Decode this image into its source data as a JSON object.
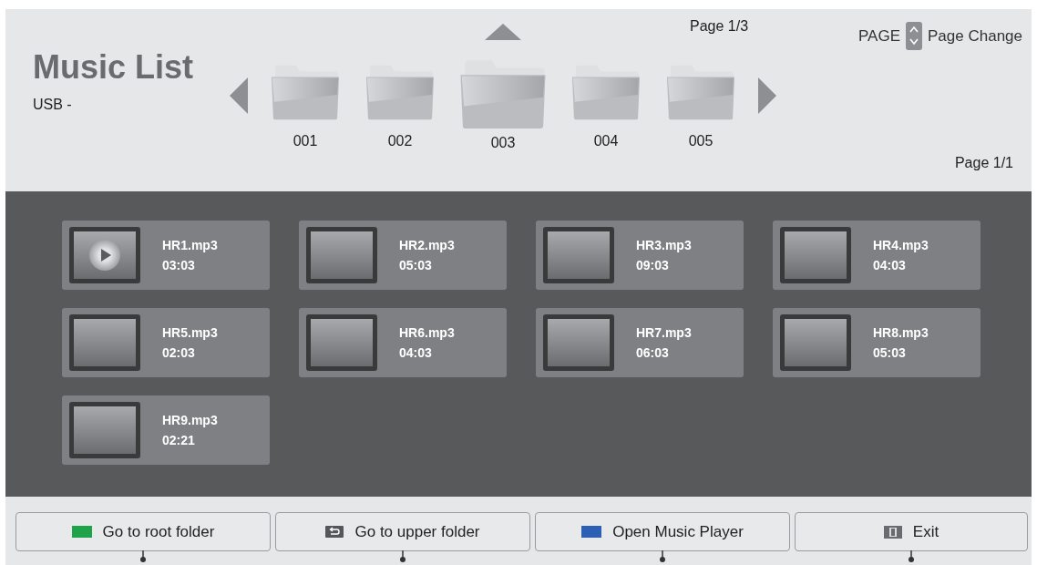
{
  "header": {
    "title": "Music List",
    "source": "USB -",
    "folder_page": "Page 1/3",
    "page_key": "PAGE",
    "page_hint": "Page Change",
    "file_page": "Page 1/1"
  },
  "folders": [
    {
      "label": "001",
      "selected": false
    },
    {
      "label": "002",
      "selected": false
    },
    {
      "label": "003",
      "selected": true
    },
    {
      "label": "004",
      "selected": false
    },
    {
      "label": "005",
      "selected": false
    }
  ],
  "tracks": [
    {
      "name": "HR1.mp3",
      "duration": "03:03",
      "playing": true
    },
    {
      "name": "HR2.mp3",
      "duration": "05:03",
      "playing": false
    },
    {
      "name": "HR3.mp3",
      "duration": "09:03",
      "playing": false
    },
    {
      "name": "HR4.mp3",
      "duration": "04:03",
      "playing": false
    },
    {
      "name": "HR5.mp3",
      "duration": "02:03",
      "playing": false
    },
    {
      "name": "HR6.mp3",
      "duration": "04:03",
      "playing": false
    },
    {
      "name": "HR7.mp3",
      "duration": "06:03",
      "playing": false
    },
    {
      "name": "HR8.mp3",
      "duration": "05:03",
      "playing": false
    },
    {
      "name": "HR9.mp3",
      "duration": "02:21",
      "playing": false
    }
  ],
  "buttons": [
    {
      "label": "Go to root folder",
      "kind": "green"
    },
    {
      "label": "Go to upper folder",
      "kind": "back"
    },
    {
      "label": "Open Music Player",
      "kind": "blue"
    },
    {
      "label": "Exit",
      "kind": "exit"
    }
  ]
}
